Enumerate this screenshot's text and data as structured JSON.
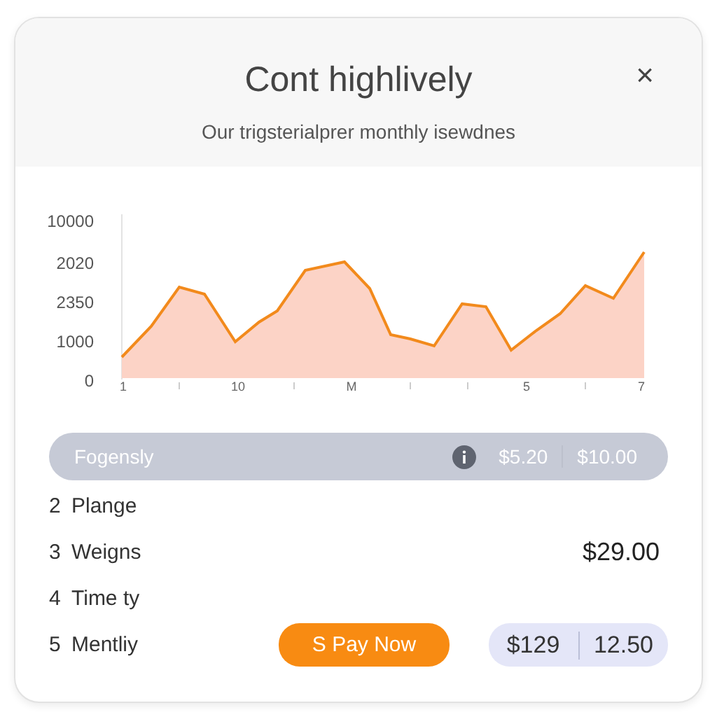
{
  "dialog": {
    "title": "Cont highlively",
    "subtitle": "Our trigsterialprer monthly isewdnes",
    "close": "×"
  },
  "chart": {
    "y_labels": [
      "10000",
      "2020",
      "2350",
      "1000",
      "0"
    ],
    "x_labels": [
      "1",
      "10",
      "M",
      "5",
      "7"
    ]
  },
  "rows": [
    {
      "kind": "band",
      "label": "Fogensly",
      "values": [
        "$5.20",
        "$10.00"
      ]
    },
    {
      "kind": "plain",
      "number": "2",
      "label": "Plange"
    },
    {
      "kind": "price",
      "number": "3",
      "label": "Weigns",
      "value": "$29.00"
    },
    {
      "kind": "plain",
      "number": "4",
      "label": "Time ty"
    },
    {
      "kind": "action",
      "number": "5",
      "label": "Mentliy",
      "button": "S Pay Now",
      "values": [
        "$129",
        "12.50"
      ]
    }
  ]
}
